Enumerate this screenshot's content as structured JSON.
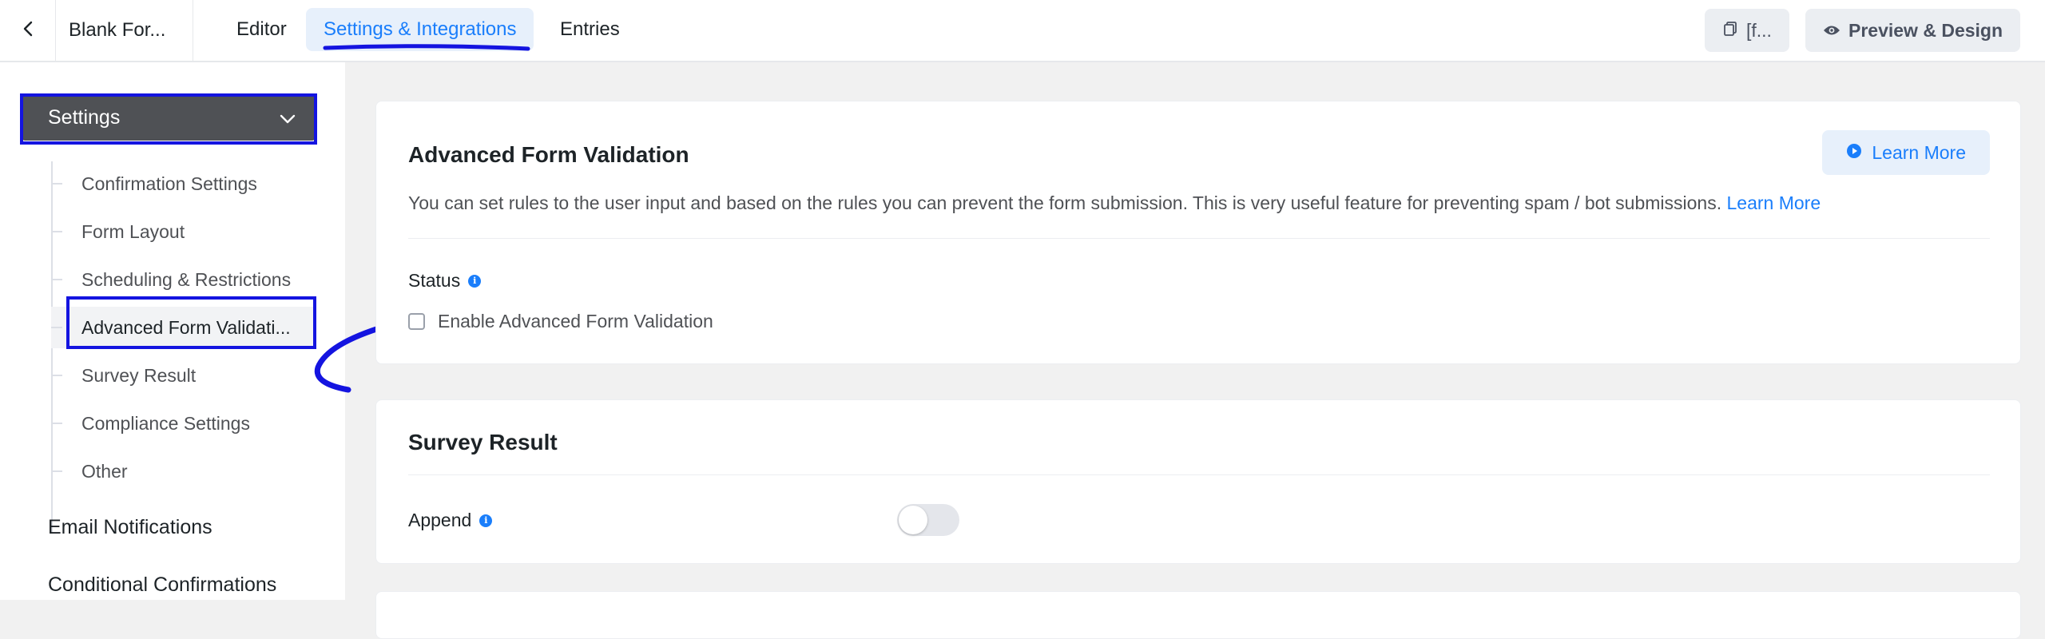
{
  "topbar": {
    "form_name": "Blank For...",
    "tabs": [
      {
        "label": "Editor"
      },
      {
        "label": "Settings & Integrations"
      },
      {
        "label": "Entries"
      }
    ],
    "shortcode_label": "[f...",
    "preview_label": "Preview & Design"
  },
  "sidebar": {
    "section_label": "Settings",
    "items": [
      {
        "label": "Confirmation Settings"
      },
      {
        "label": "Form Layout"
      },
      {
        "label": "Scheduling & Restrictions"
      },
      {
        "label": "Advanced Form Validati..."
      },
      {
        "label": "Survey Result"
      },
      {
        "label": "Compliance Settings"
      },
      {
        "label": "Other"
      }
    ],
    "main_items": [
      {
        "label": "Email Notifications"
      },
      {
        "label": "Conditional Confirmations"
      }
    ]
  },
  "validation_card": {
    "title": "Advanced Form Validation",
    "learn_more_button": "Learn More",
    "description": "You can set rules to the user input and based on the rules you can prevent the form submission. This is very useful feature for preventing spam / bot submissions.",
    "description_link": "Learn More",
    "status_label": "Status",
    "checkbox_label": "Enable Advanced Form Validation",
    "checkbox_checked": false
  },
  "survey_card": {
    "title": "Survey Result",
    "append_label": "Append",
    "append_enabled": false
  },
  "colors": {
    "accent": "#1a7efb",
    "annotation": "#1414e0",
    "sidebar_header": "#4f5155"
  }
}
